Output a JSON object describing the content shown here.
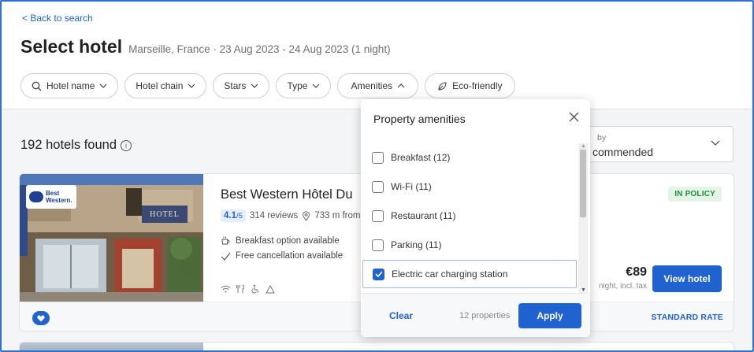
{
  "nav": {
    "back_label": "< Back to search"
  },
  "header": {
    "title": "Select hotel",
    "subtitle": "Marseille, France · 23 Aug 2023 - 24 Aug 2023 (1 night)"
  },
  "filters": {
    "hotel_name": "Hotel name",
    "hotel_chain": "Hotel chain",
    "stars": "Stars",
    "type": "Type",
    "amenities": "Amenities",
    "eco": "Eco-friendly"
  },
  "results": {
    "count_text": "192 hotels found"
  },
  "sort": {
    "label": "by",
    "value": "commended"
  },
  "hotel": {
    "logo_line1": "Best",
    "logo_line2": "Western.",
    "sign_text": "HOTEL",
    "name": "Best Western Hôtel Du",
    "rating": "4.1",
    "rating_scale": "/5",
    "reviews": "314 reviews",
    "distance": "733 m from",
    "breakfast": "Breakfast option available",
    "cancellation": "Free cancellation available",
    "policy_badge": "IN POLICY",
    "price": "€89",
    "price_note": "night, incl. tax",
    "view_button": "View hotel",
    "rate_label": "STANDARD RATE"
  },
  "amenities_dropdown": {
    "title": "Property amenities",
    "items": [
      {
        "label": "Breakfast (12)",
        "checked": false
      },
      {
        "label": "Wi-Fi (11)",
        "checked": false
      },
      {
        "label": "Restaurant (11)",
        "checked": false
      },
      {
        "label": "Parking (11)",
        "checked": false
      },
      {
        "label": "Electric car charging station",
        "checked": true
      }
    ],
    "clear_label": "Clear",
    "properties_count": "12 properties",
    "apply_label": "Apply"
  },
  "colors": {
    "accent": "#1f62d0",
    "policy_green": "#1f8f3c",
    "page_bg": "#f4f5f7",
    "frame_border": "#2f6fd6"
  },
  "icons": [
    "search-icon",
    "chevron-down-icon",
    "chevron-up-icon",
    "leaf-icon",
    "info-icon",
    "close-icon",
    "location-pin-icon",
    "breakfast-icon",
    "check-icon",
    "wifi-icon",
    "restaurant-icon",
    "accessible-icon",
    "parking-icon",
    "heart-icon"
  ]
}
